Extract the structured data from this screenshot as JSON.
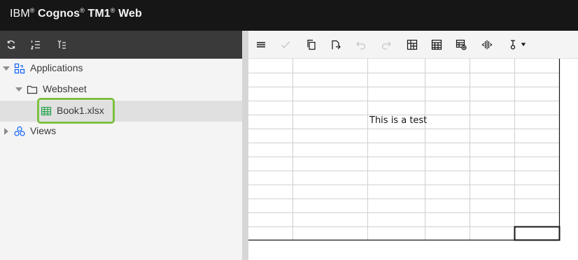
{
  "header": {
    "brand_prefix": "IBM",
    "brand_mark_1": "®",
    "brand_product": "Cognos",
    "brand_mark_2": "®",
    "brand_tm1": "TM1",
    "brand_mark_3": "®",
    "brand_web": "Web"
  },
  "left_toolbar": {
    "icons": [
      "refresh-icon",
      "list-order-icon",
      "collapse-tree-icon"
    ]
  },
  "tree": {
    "items": [
      {
        "label": "Applications",
        "icon": "applications-icon",
        "expanded": true
      },
      {
        "label": "Websheet",
        "icon": "folder-icon",
        "expanded": true
      },
      {
        "label": "Book1.xlsx",
        "icon": "spreadsheet-icon",
        "selected": true
      },
      {
        "label": "Views",
        "icon": "views-icon",
        "expanded": false
      }
    ]
  },
  "right_toolbar": {
    "icons": [
      "menu-icon",
      "commit-check-icon",
      "copy-icon",
      "paste-icon",
      "undo-icon",
      "redo-icon",
      "grid-settings-icon",
      "table-icon",
      "table-add-icon",
      "split-columns-icon",
      "sandbox-dropdown-icon"
    ]
  },
  "sheet": {
    "cell_text": "This is a test",
    "colors": {
      "grid_line": "#d0d0d0",
      "border": "#161616"
    }
  },
  "colors": {
    "topbar": "#161616",
    "left_toolbar": "#3a3a3a",
    "tree_bg": "#f4f4f4",
    "selected_row": "#e0e0e0",
    "highlight": "#7dc142",
    "accent_icon": "#0f62fe"
  }
}
